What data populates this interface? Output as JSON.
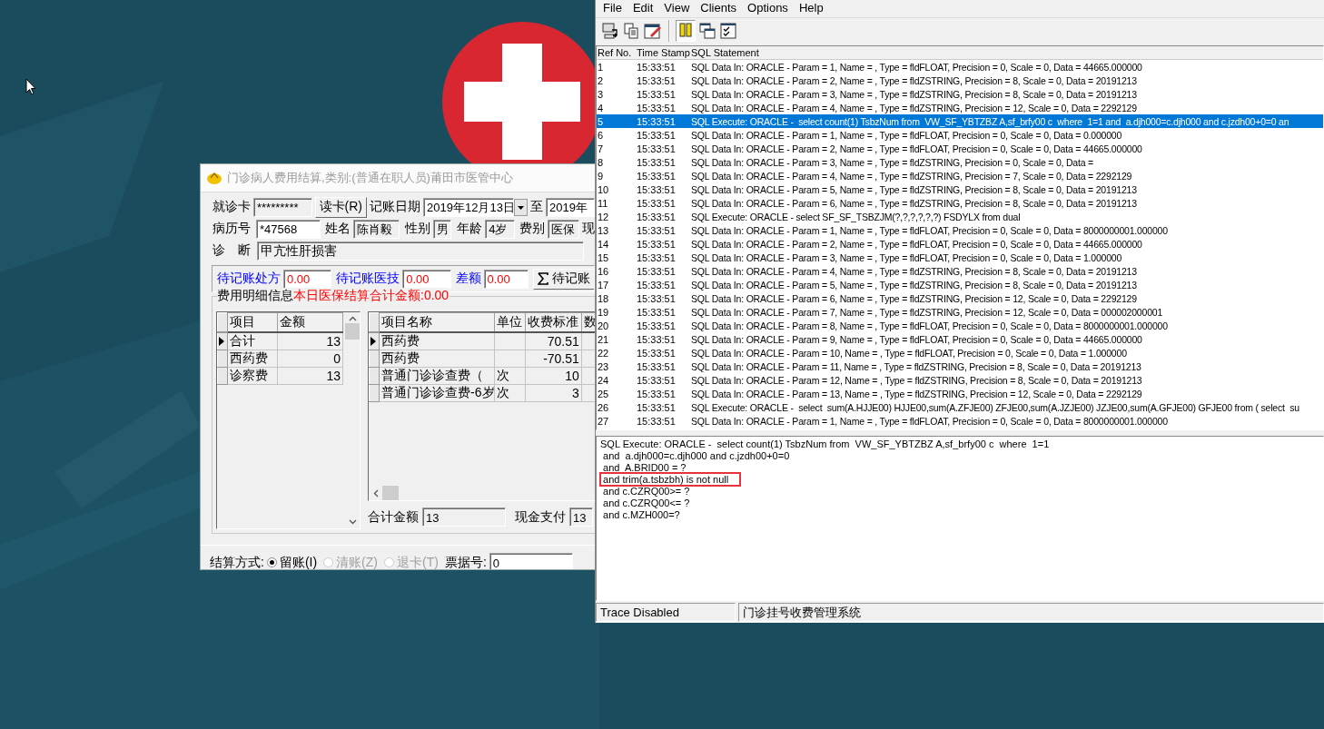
{
  "settle_window": {
    "title": "门诊病人费用结算,类别:(普通在职人员)莆田市医管中心",
    "card_label": "就诊卡",
    "card_value": "*********",
    "read_button": "读卡(R)",
    "date_label": "记账日期",
    "date_from": "2019年12月13日",
    "date_sep": "至",
    "date_to": "2019年",
    "record_label": "病历号",
    "record_value": "*47568",
    "name_label": "姓名",
    "name_value": "陈肖毅",
    "sex_label": "性别",
    "sex_value": "男",
    "age_label": "年龄",
    "age_value": "4岁",
    "fee_label": "费别",
    "fee_value": "医保",
    "cut_label": "现",
    "diag_label": "诊　断",
    "diag_value": "甲亢性肝损害",
    "pending": [
      {
        "label": "待记账处方",
        "value": "0.00"
      },
      {
        "label": "待记账医技",
        "value": "0.00"
      },
      {
        "label": "差额",
        "value": "0.00"
      }
    ],
    "pending_button": "待记账",
    "group_title": "费用明细信息",
    "group_note": "本日医保结算合计金额:0.00",
    "summary_table": {
      "columns": [
        "项目",
        "金额"
      ],
      "rows": [
        {
          "item": "合计",
          "amount": "13",
          "selected": true
        },
        {
          "item": "西药费",
          "amount": "0",
          "selected": false
        },
        {
          "item": "诊察费",
          "amount": "13",
          "selected": false
        }
      ]
    },
    "detail_table": {
      "columns": [
        "项目名称",
        "单位",
        "收费标准",
        "数"
      ],
      "rows": [
        {
          "name": "西药费",
          "price": "70.51",
          "selected": true
        },
        {
          "name": "西药费",
          "price": "-70.51",
          "selected": false
        },
        {
          "name": "普通门诊诊查费（",
          "unit": "次",
          "price": "10",
          "selected": false
        },
        {
          "name": "普通门诊诊查费-6岁",
          "unit": "次",
          "price": "3",
          "selected": false
        }
      ]
    },
    "totals": [
      {
        "label": "合计金额",
        "value": "13"
      },
      {
        "label": "现金支付",
        "value": "13"
      }
    ],
    "settle_label": "结算方式:",
    "settle_options": [
      {
        "label": "留账(I)",
        "selected": true,
        "disabled": false
      },
      {
        "label": "清账(Z)",
        "selected": false,
        "disabled": true
      },
      {
        "label": "退卡(T)",
        "selected": false,
        "disabled": true
      }
    ],
    "receipt_label": "票据号:",
    "receipt_value": "0"
  },
  "trace_window": {
    "menu": [
      "File",
      "Edit",
      "View",
      "Clients",
      "Options",
      "Help"
    ],
    "columns": [
      "Ref No.",
      "Time Stamp",
      "SQL Statement"
    ],
    "rows": [
      {
        "ref": "1",
        "time": "15:33:51",
        "statement": "SQL Data In: ORACLE - Param = 1, Name = , Type = fldFLOAT, Precision = 0, Scale = 0, Data = 44665.000000",
        "selected": false
      },
      {
        "ref": "2",
        "time": "15:33:51",
        "statement": "SQL Data In: ORACLE - Param = 2, Name = , Type = fldZSTRING, Precision = 8, Scale = 0, Data = 20191213",
        "selected": false
      },
      {
        "ref": "3",
        "time": "15:33:51",
        "statement": "SQL Data In: ORACLE - Param = 3, Name = , Type = fldZSTRING, Precision = 8, Scale = 0, Data = 20191213",
        "selected": false
      },
      {
        "ref": "4",
        "time": "15:33:51",
        "statement": "SQL Data In: ORACLE - Param = 4, Name = , Type = fldZSTRING, Precision = 12, Scale = 0, Data = 2292129",
        "selected": false
      },
      {
        "ref": "5",
        "time": "15:33:51",
        "statement": "SQL Execute: ORACLE -  select count(1) TsbzNum from  VW_SF_YBTZBZ A,sf_brfy00 c  where  1=1 and  a.djh000=c.djh000 and c.jzdh00+0=0 an",
        "selected": true
      },
      {
        "ref": "6",
        "time": "15:33:51",
        "statement": "SQL Data In: ORACLE - Param = 1, Name = , Type = fldFLOAT, Precision = 0, Scale = 0, Data = 0.000000",
        "selected": false
      },
      {
        "ref": "7",
        "time": "15:33:51",
        "statement": "SQL Data In: ORACLE - Param = 2, Name = , Type = fldFLOAT, Precision = 0, Scale = 0, Data = 44665.000000",
        "selected": false
      },
      {
        "ref": "8",
        "time": "15:33:51",
        "statement": "SQL Data In: ORACLE - Param = 3, Name = , Type = fldZSTRING, Precision = 0, Scale = 0, Data =",
        "selected": false
      },
      {
        "ref": "9",
        "time": "15:33:51",
        "statement": "SQL Data In: ORACLE - Param = 4, Name = , Type = fldZSTRING, Precision = 7, Scale = 0, Data = 2292129",
        "selected": false
      },
      {
        "ref": "10",
        "time": "15:33:51",
        "statement": "SQL Data In: ORACLE - Param = 5, Name = , Type = fldZSTRING, Precision = 8, Scale = 0, Data = 20191213",
        "selected": false
      },
      {
        "ref": "11",
        "time": "15:33:51",
        "statement": "SQL Data In: ORACLE - Param = 6, Name = , Type = fldZSTRING, Precision = 8, Scale = 0, Data = 20191213",
        "selected": false
      },
      {
        "ref": "12",
        "time": "15:33:51",
        "statement": "SQL Execute: ORACLE - select SF_SF_TSBZJM(?,?,?,?,?,?) FSDYLX from dual",
        "selected": false
      },
      {
        "ref": "13",
        "time": "15:33:51",
        "statement": "SQL Data In: ORACLE - Param = 1, Name = , Type = fldFLOAT, Precision = 0, Scale = 0, Data = 8000000001.000000",
        "selected": false
      },
      {
        "ref": "14",
        "time": "15:33:51",
        "statement": "SQL Data In: ORACLE - Param = 2, Name = , Type = fldFLOAT, Precision = 0, Scale = 0, Data = 44665.000000",
        "selected": false
      },
      {
        "ref": "15",
        "time": "15:33:51",
        "statement": "SQL Data In: ORACLE - Param = 3, Name = , Type = fldFLOAT, Precision = 0, Scale = 0, Data = 1.000000",
        "selected": false
      },
      {
        "ref": "16",
        "time": "15:33:51",
        "statement": "SQL Data In: ORACLE - Param = 4, Name = , Type = fldZSTRING, Precision = 8, Scale = 0, Data = 20191213",
        "selected": false
      },
      {
        "ref": "17",
        "time": "15:33:51",
        "statement": "SQL Data In: ORACLE - Param = 5, Name = , Type = fldZSTRING, Precision = 8, Scale = 0, Data = 20191213",
        "selected": false
      },
      {
        "ref": "18",
        "time": "15:33:51",
        "statement": "SQL Data In: ORACLE - Param = 6, Name = , Type = fldZSTRING, Precision = 12, Scale = 0, Data = 2292129",
        "selected": false
      },
      {
        "ref": "19",
        "time": "15:33:51",
        "statement": "SQL Data In: ORACLE - Param = 7, Name = , Type = fldZSTRING, Precision = 12, Scale = 0, Data = 000002000001",
        "selected": false
      },
      {
        "ref": "20",
        "time": "15:33:51",
        "statement": "SQL Data In: ORACLE - Param = 8, Name = , Type = fldFLOAT, Precision = 0, Scale = 0, Data = 8000000001.000000",
        "selected": false
      },
      {
        "ref": "21",
        "time": "15:33:51",
        "statement": "SQL Data In: ORACLE - Param = 9, Name = , Type = fldFLOAT, Precision = 0, Scale = 0, Data = 44665.000000",
        "selected": false
      },
      {
        "ref": "22",
        "time": "15:33:51",
        "statement": "SQL Data In: ORACLE - Param = 10, Name = , Type = fldFLOAT, Precision = 0, Scale = 0, Data = 1.000000",
        "selected": false
      },
      {
        "ref": "23",
        "time": "15:33:51",
        "statement": "SQL Data In: ORACLE - Param = 11, Name = , Type = fldZSTRING, Precision = 8, Scale = 0, Data = 20191213",
        "selected": false
      },
      {
        "ref": "24",
        "time": "15:33:51",
        "statement": "SQL Data In: ORACLE - Param = 12, Name = , Type = fldZSTRING, Precision = 8, Scale = 0, Data = 20191213",
        "selected": false
      },
      {
        "ref": "25",
        "time": "15:33:51",
        "statement": "SQL Data In: ORACLE - Param = 13, Name = , Type = fldZSTRING, Precision = 12, Scale = 0, Data = 2292129",
        "selected": false
      },
      {
        "ref": "26",
        "time": "15:33:51",
        "statement": "SQL Execute: ORACLE -  select  sum(A.HJJE00) HJJE00,sum(A.ZFJE00) ZFJE00,sum(A.JZJE00) JZJE00,sum(A.GFJE00) GFJE00 from ( select  su",
        "selected": false
      },
      {
        "ref": "27",
        "time": "15:33:51",
        "statement": "SQL Data In: ORACLE - Param = 1, Name = , Type = fldFLOAT, Precision = 0, Scale = 0, Data = 8000000001.000000",
        "selected": false
      }
    ],
    "detail_lines": [
      "SQL Execute: ORACLE -  select count(1) TsbzNum from  VW_SF_YBTZBZ A,sf_brfy00 c  where  1=1",
      " and  a.djh000=c.djh000 and c.jzdh00+0=0",
      " and  A.BRID00 = ?",
      " and trim(a.tsbzbh) is not null",
      " and c.CZRQ00>= ?",
      " and c.CZRQ00<= ?",
      " and c.MZH000=?"
    ],
    "status": [
      "Trace Disabled",
      "门诊挂号收费管理系统"
    ]
  }
}
